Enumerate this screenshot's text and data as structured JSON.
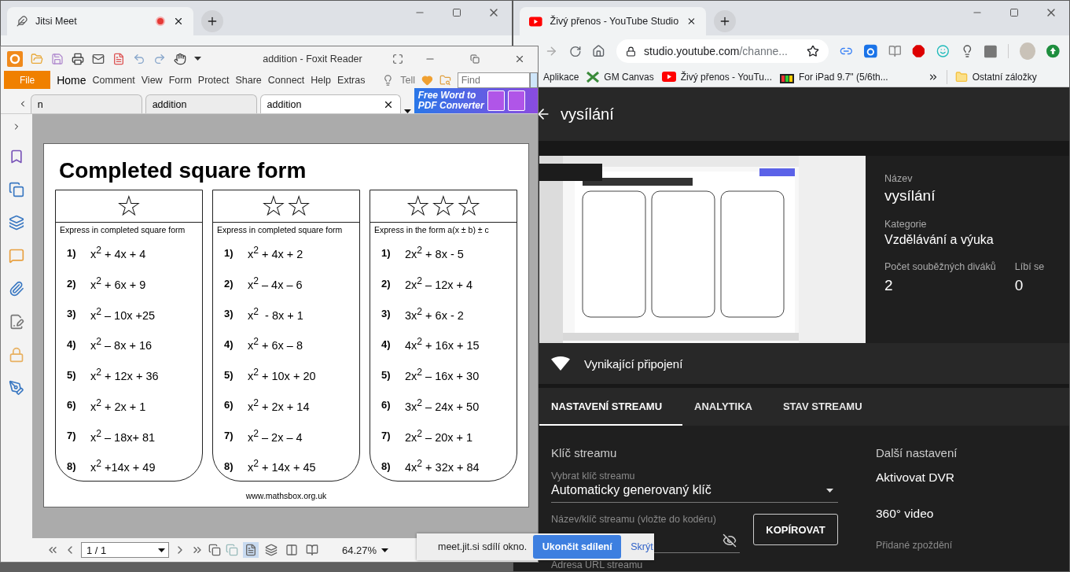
{
  "jitsi_window": {
    "tab_title": "Jitsi Meet",
    "recording": true
  },
  "foxit": {
    "title": "addition - Foxit Reader",
    "file_button": "File",
    "menu": [
      {
        "label": "Home",
        "selected": true
      },
      {
        "label": "Comment",
        "selected": false
      },
      {
        "label": "View",
        "selected": false
      },
      {
        "label": "Form",
        "selected": false
      },
      {
        "label": "Protect",
        "selected": false
      },
      {
        "label": "Share",
        "selected": false
      },
      {
        "label": "Connect",
        "selected": false
      },
      {
        "label": "Help",
        "selected": false
      },
      {
        "label": "Extras",
        "selected": false
      }
    ],
    "tell": "Tell",
    "find_placeholder": "Find",
    "doc_tabs": [
      {
        "label": "n",
        "selected": false
      },
      {
        "label": "addition",
        "selected": false
      },
      {
        "label": "addition",
        "selected": true
      }
    ],
    "ad": {
      "line_1": "**Free** Word to",
      "line_2": "PDF Converter"
    },
    "document": {
      "title": "Completed square form",
      "columns": [
        {
          "star_text": "☆",
          "instruction": "Express in completed square form",
          "items": [
            {
              "num": "1)",
              "expr": "x$^{2}$ + 4x + 4"
            },
            {
              "num": "2)",
              "expr": "x$^{2}$ + 6x + 9"
            },
            {
              "num": "3)",
              "expr": "x$^{2}$ – 10x +25"
            },
            {
              "num": "4)",
              "expr": "x$^{2}$ – 8x + 16"
            },
            {
              "num": "5)",
              "expr": "x$^{2}$ + 12x + 36"
            },
            {
              "num": "6)",
              "expr": "x$^{2}$ + 2x + 1"
            },
            {
              "num": "7)",
              "expr": "x$^{2}$ – 18x+ 81"
            },
            {
              "num": "8)",
              "expr": "x$^{2}$ +14x + 49"
            }
          ]
        },
        {
          "star_text": "☆☆",
          "instruction": "Express in completed square form",
          "items": [
            {
              "num": "1)",
              "expr": "x$^{2}$ + 4x + 2"
            },
            {
              "num": "2)",
              "expr": "x$^{2}$ – 4x – 6"
            },
            {
              "num": "3)",
              "expr": "x$^{2}$  - 8x + 1"
            },
            {
              "num": "4)",
              "expr": "x$^{2}$ + 6x – 8"
            },
            {
              "num": "5)",
              "expr": "x$^{2}$ + 10x + 20"
            },
            {
              "num": "6)",
              "expr": "x$^{2}$ + 2x + 14"
            },
            {
              "num": "7)",
              "expr": "x$^{2}$ – 2x – 4"
            },
            {
              "num": "8)",
              "expr": "x$^{2}$ + 14x + 45"
            }
          ]
        },
        {
          "star_text": "☆☆☆",
          "instruction": "Express in the form a(x ± b) ± c",
          "items": [
            {
              "num": "1)",
              "expr": "2x$^{2}$ + 8x - 5"
            },
            {
              "num": "2)",
              "expr": "2x$^{2}$ – 12x + 4"
            },
            {
              "num": "3)",
              "expr": "3x$^{2}$ + 6x - 2"
            },
            {
              "num": "4)",
              "expr": "4x$^{2}$ + 16x + 15"
            },
            {
              "num": "5)",
              "expr": "2x$^{2}$ – 16x + 30"
            },
            {
              "num": "6)",
              "expr": "3x$^{2}$ – 24x + 50"
            },
            {
              "num": "7)",
              "expr": "2x$^{2}$ – 20x + 1"
            },
            {
              "num": "8)",
              "expr": "4x$^{2}$ + 32x + 84"
            }
          ]
        }
      ],
      "footer": "www.mathsbox.org.uk"
    },
    "page_field": "1 / 1",
    "zoom": "64.27%"
  },
  "youtube_window": {
    "tab_title": "Živý přenos - YouTube Studio",
    "url_host": "studio.youtube.com",
    "url_path": "/channe...",
    "bookmarks": [
      {
        "label": "Aplikace",
        "kind": "plain"
      },
      {
        "label": "GM Canvas",
        "kind": "canvas"
      },
      {
        "label": "Živý přenos - YouTu...",
        "kind": "youtube"
      },
      {
        "label": "For iPad 9.7\" (5/6th...",
        "kind": "shop"
      }
    ],
    "other_bookmarks": "Ostatní záložky"
  },
  "studio": {
    "header": "vysílání",
    "details": [
      {
        "label": "Název",
        "value": "vysílání"
      },
      {
        "label": "Kategorie",
        "value": "Vzdělávání a výuka"
      }
    ],
    "stats": [
      {
        "label": "Počet souběžných diváků",
        "value": "2"
      },
      {
        "label": "Líbí se",
        "value": "0"
      }
    ],
    "connection": "Vynikající připojení",
    "tabs": [
      {
        "label": "NASTAVENÍ STREAMU",
        "selected": true
      },
      {
        "label": "ANALYTIKA",
        "selected": false
      },
      {
        "label": "STAV STREAMU",
        "selected": false
      }
    ],
    "stream_key": {
      "heading": "Klíč streamu",
      "select_label": "Vybrat klíč streamu",
      "select_value": "Automaticky generovaný klíč",
      "key_label": "Název/klíč streamu (vložte do kodéru)",
      "copy_button": "KOPÍROVAT",
      "url_label": "Adresa URL streamu"
    },
    "more_settings": {
      "heading": "Další nastavení",
      "items": [
        "Aktivovat DVR",
        "360° video"
      ],
      "delay_label": "Přidané zpoždění"
    }
  },
  "share_bar": {
    "message": "meet.jit.si sdílí okno.",
    "stop_button": "Ukončit sdílení",
    "hide_link": "Skrýt"
  }
}
